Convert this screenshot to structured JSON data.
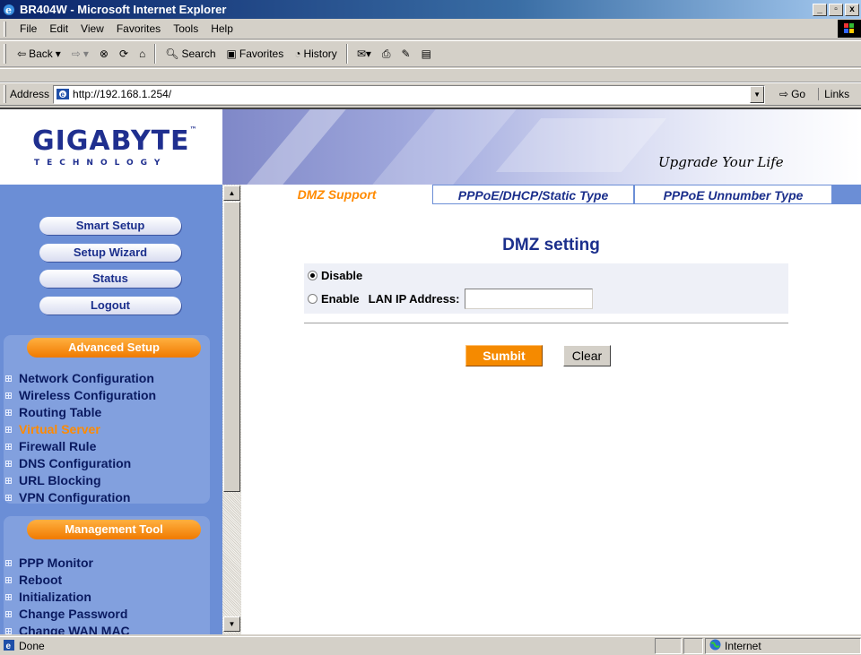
{
  "window": {
    "title": "BR404W - Microsoft Internet Explorer",
    "controls": [
      "_",
      "&#x25A1;",
      "X"
    ]
  },
  "menu": [
    "File",
    "Edit",
    "View",
    "Favorites",
    "Tools",
    "Help"
  ],
  "toolbar": {
    "back": "Back",
    "search": "Search",
    "favorites": "Favorites",
    "history": "History"
  },
  "address": {
    "label": "Address",
    "url": "http://192.168.1.254/",
    "go": "Go",
    "links": "Links"
  },
  "banner": {
    "logo": "GIGABYTE",
    "logo_sub": "TECHNOLOGY",
    "tagline": "Upgrade Your Life"
  },
  "sidebar": {
    "buttons": [
      "Smart Setup",
      "Setup Wizard",
      "Status",
      "Logout"
    ],
    "advanced_header": "Advanced Setup",
    "advanced_items": [
      "Network Configuration",
      "Wireless Configuration",
      "Routing Table",
      "Virtual Server",
      "Firewall Rule",
      "DNS Configuration",
      "URL Blocking",
      "VPN Configuration"
    ],
    "management_header": "Management Tool",
    "management_items": [
      "PPP Monitor",
      "Reboot",
      "Initialization",
      "Change Password",
      "Change WAN MAC"
    ]
  },
  "tabs": [
    "DMZ Support",
    "PPPoE/DHCP/Static Type",
    "PPPoE Unnumber Type"
  ],
  "form": {
    "heading": "DMZ setting",
    "disable_label": "Disable",
    "enable_label": "Enable",
    "lan_ip_label": "LAN IP Address:",
    "lan_ip_value": "",
    "selected": "Disable",
    "submit": "Sumbit",
    "clear": "Clear"
  },
  "status": {
    "text": "Done",
    "zone": "Internet"
  },
  "colors": {
    "sidebar": "#6b8ed6",
    "accent": "#f58a00",
    "link": "#1b2f8c"
  }
}
